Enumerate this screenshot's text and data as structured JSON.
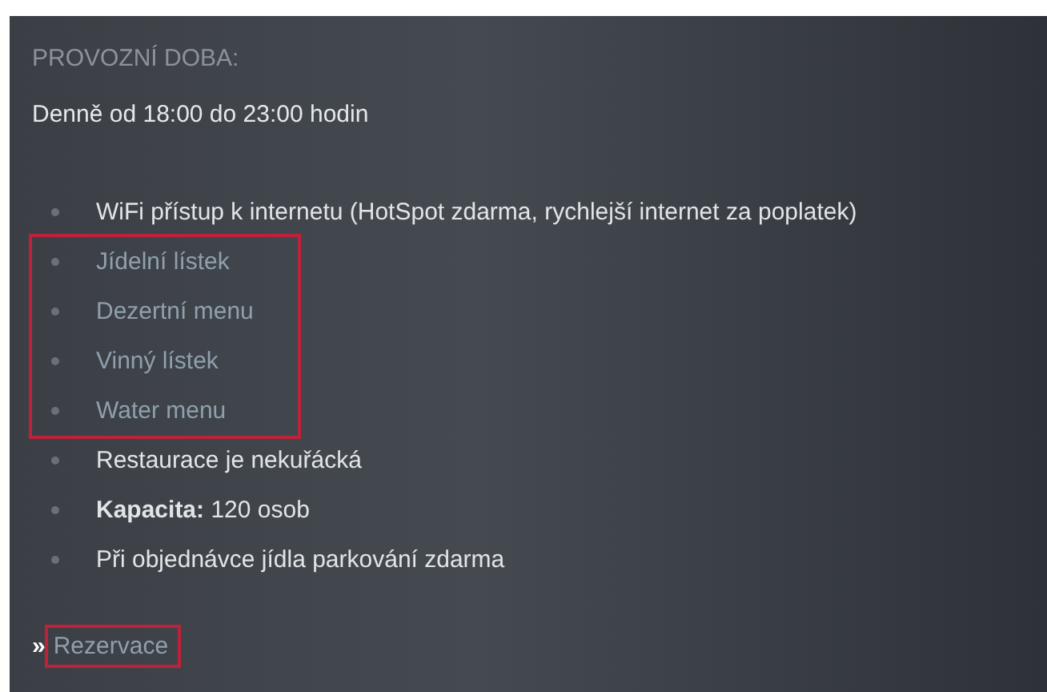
{
  "heading": "PROVOZNÍ DOBA:",
  "hours": "Denně od 18:00 do 23:00 hodin",
  "items": [
    {
      "kind": "text",
      "text": "WiFi přístup k internetu (HotSpot zdarma, rychlejší internet za poplatek)",
      "highlighted": false
    },
    {
      "kind": "link",
      "text": "Jídelní lístek",
      "highlighted": true
    },
    {
      "kind": "link",
      "text": "Dezertní menu",
      "highlighted": true
    },
    {
      "kind": "link",
      "text": "Vinný lístek",
      "highlighted": true
    },
    {
      "kind": "link",
      "text": "Water menu",
      "highlighted": true
    },
    {
      "kind": "text",
      "text": "Restaurace je nekuřácká",
      "highlighted": false
    },
    {
      "kind": "text",
      "text": "**Kapacita:** 120 osob",
      "highlighted": false
    },
    {
      "kind": "text",
      "text": "Při objednávce jídla parkování zdarma",
      "highlighted": false
    }
  ],
  "reservation": {
    "marker": "»",
    "text": "Rezervace",
    "highlighted": true
  }
}
